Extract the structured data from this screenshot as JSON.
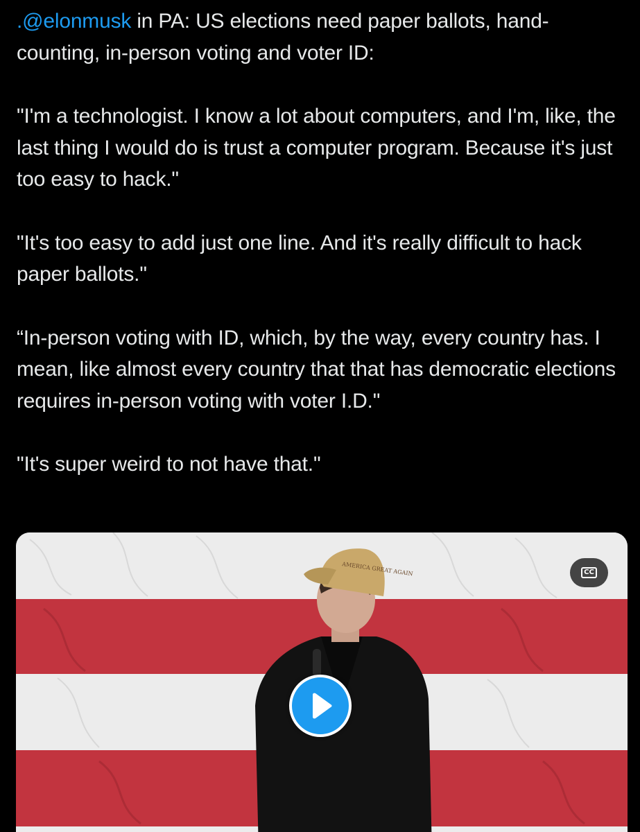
{
  "tweet": {
    "mention": ".@elonmusk",
    "headline_rest": " in PA: US elections need paper ballots, hand-counting, in-person voting and voter ID:",
    "paragraph_1": "\"I'm a technologist. I know a lot about computers, and I'm, like, the last thing I would do is trust a computer program. Because it's just too easy to hack.\"",
    "paragraph_2": "\"It's too easy to add just one line. And it's really difficult to hack paper ballots.\"",
    "paragraph_3": "“In-person voting with ID, which, by the way, every country has. I mean, like almost every country that that has democratic elections requires in-person voting with voter I.D.\"",
    "paragraph_4": "\"It's super weird to not have that.\""
  },
  "media": {
    "cc_label": "CC",
    "hat_text": "AMERICA GREAT AGAIN",
    "play_icon": "play-icon",
    "caption_icon": "closed-captions-icon"
  },
  "colors": {
    "background": "#000000",
    "text": "#e7e9ea",
    "link": "#1d9bf0",
    "play_button": "#1d9bf0",
    "flag_red": "#c2343f",
    "flag_white": "#ececec"
  }
}
